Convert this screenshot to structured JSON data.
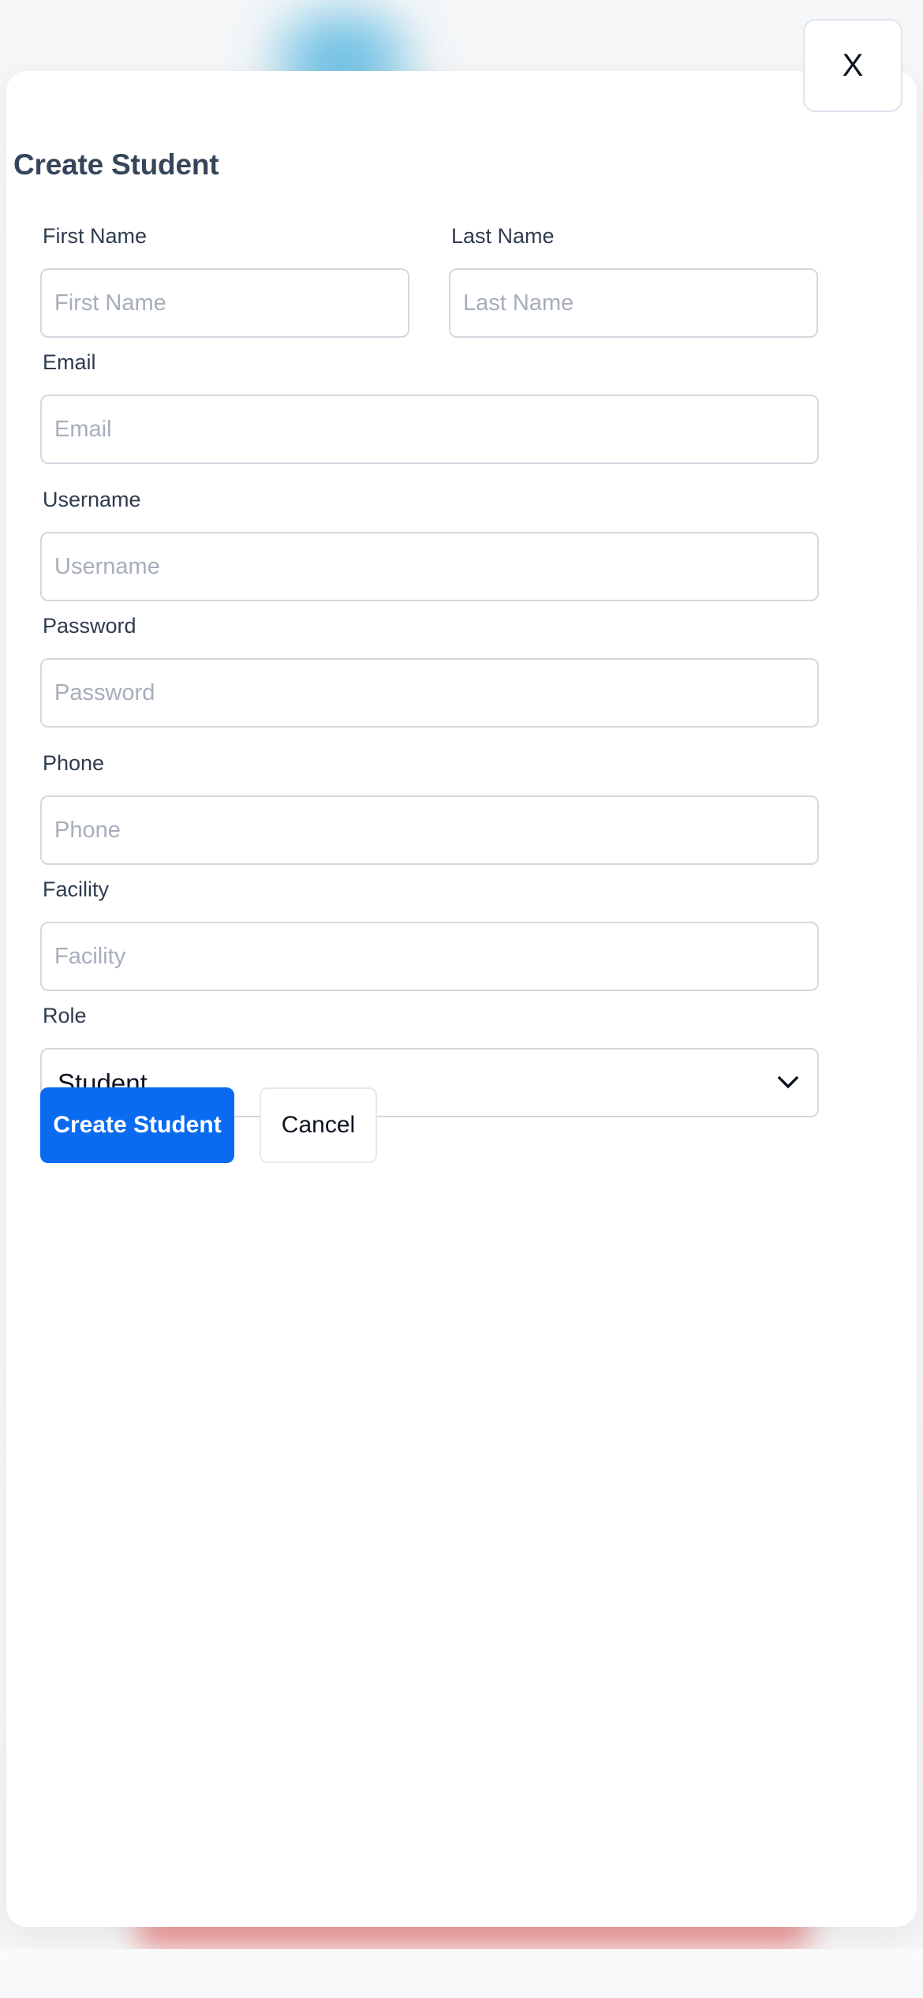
{
  "background": {
    "glow_blue_color": "#54b6e0",
    "glow_pink_color": "#e8807f",
    "page_color": "#f7f8f9"
  },
  "modal": {
    "title": "Create Student",
    "close_button_label": "X",
    "surface_color": "#ffffff"
  },
  "form": {
    "fields": [
      {
        "label": "First Name",
        "placeholder": "First Name",
        "value": "",
        "type": "text"
      },
      {
        "label": "Last Name",
        "placeholder": "Last Name",
        "value": "",
        "type": "text"
      },
      {
        "label": "Email",
        "placeholder": "Email",
        "value": "",
        "type": "email"
      },
      {
        "label": "Username",
        "placeholder": "Username",
        "value": "",
        "type": "text"
      },
      {
        "label": "Password",
        "placeholder": "Password",
        "value": "",
        "type": "password"
      },
      {
        "label": "Phone",
        "placeholder": "Phone",
        "value": "",
        "type": "tel"
      },
      {
        "label": "Facility",
        "placeholder": "Facility",
        "value": "",
        "type": "text"
      }
    ],
    "role": {
      "label": "Role",
      "selected": "Student",
      "options": [
        "Student"
      ]
    }
  },
  "actions": {
    "submit_label": "Create Student",
    "cancel_label": "Cancel",
    "submit_color": "#0a6bf0"
  },
  "icons": {
    "chevron_down": "chevron-down-icon",
    "close": "close-icon"
  }
}
